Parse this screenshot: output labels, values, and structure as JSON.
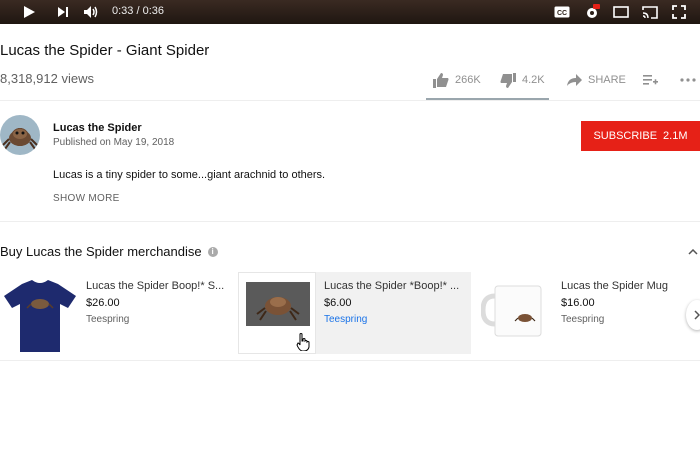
{
  "player": {
    "time_current": "0:33",
    "time_sep": " / ",
    "time_total": "0:36",
    "icons": [
      "play-icon",
      "next-icon",
      "volume-icon",
      "cc-icon",
      "settings-hd-icon",
      "miniplayer-icon",
      "cast-icon",
      "fullscreen-icon"
    ]
  },
  "video": {
    "title": "Lucas the Spider - Giant Spider",
    "views": "8,318,912 views",
    "likes": "266K",
    "dislikes": "4.2K",
    "share_label": "SHARE"
  },
  "channel": {
    "name": "Lucas the Spider",
    "published": "Published on May 19, 2018",
    "subscribe_label": "SUBSCRIBE",
    "subscriber_count": "2.1M",
    "description": "Lucas is a tiny spider to some...giant arachnid to others.",
    "show_more": "SHOW MORE"
  },
  "merch": {
    "heading": "Buy Lucas the Spider merchandise",
    "items": [
      {
        "name": "Lucas the Spider Boop!* S...",
        "price": "$26.00",
        "seller": "Teespring"
      },
      {
        "name": "Lucas the Spider *Boop!* ...",
        "price": "$6.00",
        "seller": "Teespring"
      },
      {
        "name": "Lucas the Spider Mug",
        "price": "$16.00",
        "seller": "Teespring"
      }
    ]
  },
  "colors": {
    "subscribe": "#e62117",
    "link": "#1a73e8",
    "player_bar": "#2b1f18"
  }
}
